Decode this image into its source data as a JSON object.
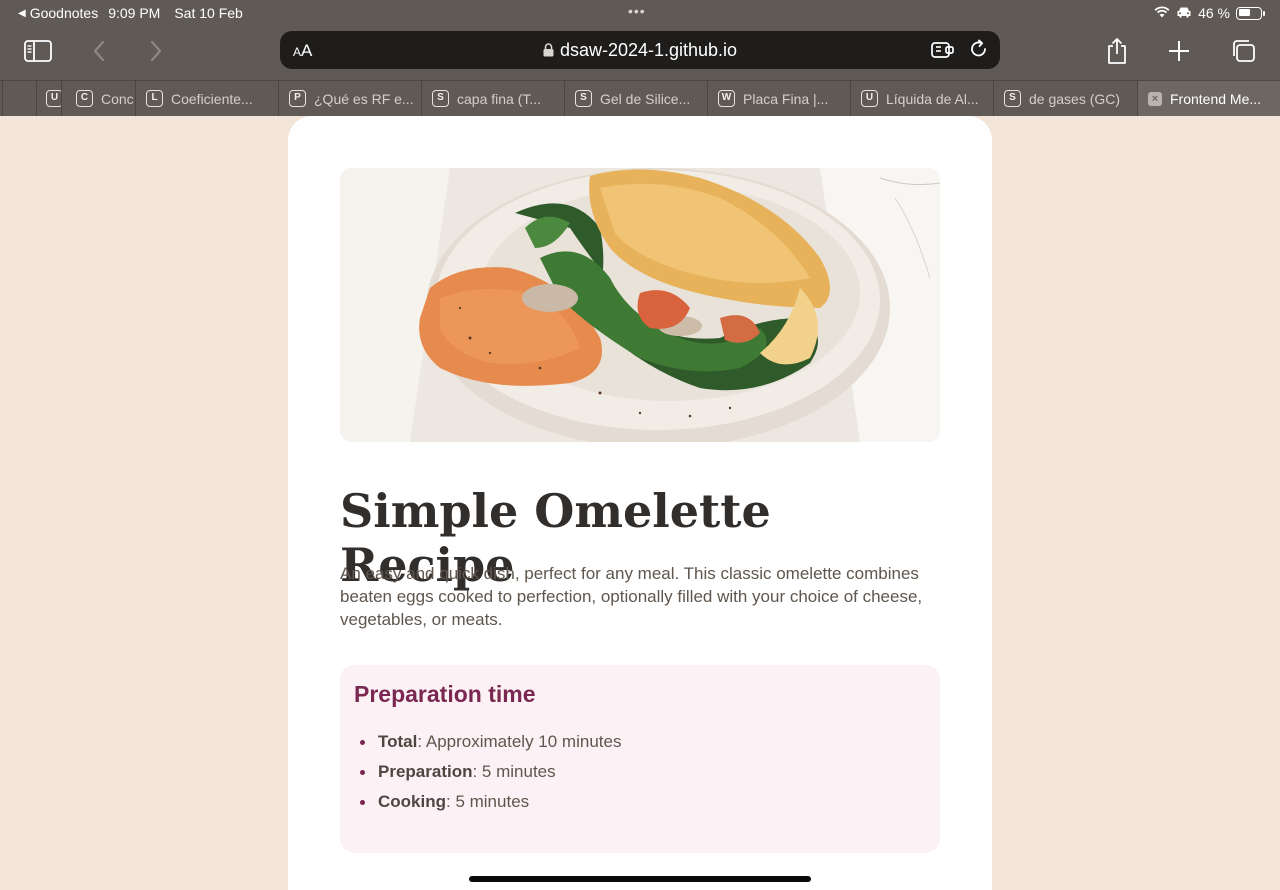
{
  "status": {
    "back_app": "Goodnotes",
    "time": "9:09 PM",
    "date": "Sat 10 Feb",
    "battery": "46 %"
  },
  "toolbar": {
    "text_size": "A",
    "text_size_small": "A",
    "url": "dsaw-2024-1.github.io"
  },
  "tabs": [
    {
      "favicon": "U",
      "label": ""
    },
    {
      "favicon": "C",
      "label": "Conc"
    },
    {
      "favicon": "L",
      "label": "Coeficiente..."
    },
    {
      "favicon": "P",
      "label": "¿Qué es RF e..."
    },
    {
      "favicon": "S",
      "label": "capa fina (T..."
    },
    {
      "favicon": "S",
      "label": "Gel de Silice..."
    },
    {
      "favicon": "W",
      "label": "Placa Fina |..."
    },
    {
      "favicon": "U",
      "label": "Líquida de Al..."
    },
    {
      "favicon": "S",
      "label": "de gases (GC)"
    },
    {
      "favicon": "×",
      "label": "Frontend Me..."
    }
  ],
  "recipe": {
    "title": "Simple Omelette Recipe",
    "description": "An easy and quick dish, perfect for any meal. This classic omelette combines beaten eggs cooked to perfection, optionally filled with your choice of cheese, vegetables, or meats.",
    "prep": {
      "heading": "Preparation time",
      "items": [
        {
          "term": "Total",
          "value": ": Approximately 10 minutes"
        },
        {
          "term": "Preparation",
          "value": ": 5 minutes"
        },
        {
          "term": "Cooking",
          "value": ": 5 minutes"
        }
      ]
    }
  },
  "colors": {
    "page_bg": "#f3e5d8",
    "heading_accent": "#7a2851",
    "prep_bg": "#fcf2f6"
  }
}
